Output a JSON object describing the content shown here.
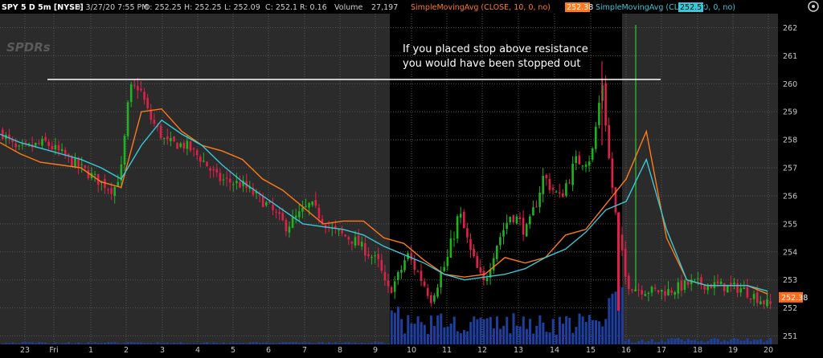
{
  "header": {
    "symbol": "SPY 5 D 5m [NYSE]",
    "date": "D: 3/27/20 7:55 PM",
    "open": "O: 252.25",
    "high": "H: 252.25",
    "low": "L: 252.09",
    "close": "C: 252.1",
    "range": "R: 0.16",
    "volume_label": "Volume",
    "volume_value": "27,197",
    "sma10_label": "SimpleMovingAvg (CLOSE, 10, 0, no)",
    "sma10_value": "252.38",
    "sma20_label": "SimpleMovingAvg (CLOSE, 20, 0, no)",
    "sma20_value": "252.57"
  },
  "watermark": "SPDRs",
  "annotation": {
    "line1": "If you placed stop above resistance",
    "line2": "you would have been stopped out"
  },
  "price_badge": "252.38",
  "colors": {
    "up": "#1fb31f",
    "down": "#e0204a",
    "sma10": "#ff7a1a",
    "sma20": "#3ac8d8",
    "volume": "#1f3f9e",
    "panel": "#2b2b2b",
    "highlight": "#000000",
    "resistance": "#ffffff",
    "badge": "#ff6a1a"
  },
  "chart_data": {
    "type": "candlestick",
    "ylim": [
      250.7,
      262.5
    ],
    "y_ticks": [
      "251",
      "252",
      "253",
      "254",
      "255",
      "256",
      "257",
      "258",
      "259",
      "260",
      "261",
      "262"
    ],
    "x_ticks": [
      "23",
      "Fri",
      "1",
      "2",
      "3",
      "4",
      "5",
      "6",
      "7",
      "8",
      "9",
      "10",
      "11",
      "12",
      "13",
      "14",
      "15",
      "16",
      "17",
      "18",
      "19",
      "20"
    ],
    "resistance_level": 260.15,
    "highlight_range": [
      "9:30",
      "15:40"
    ],
    "series": [
      {
        "name": "SimpleMovingAvg (CLOSE, 10, 0, no)",
        "points": [
          [
            0,
            257.9
          ],
          [
            1,
            257.5
          ],
          [
            2,
            257.2
          ],
          [
            3,
            257.1
          ],
          [
            4,
            257.0
          ],
          [
            5,
            256.5
          ],
          [
            6,
            256.3
          ],
          [
            7,
            259.0
          ],
          [
            8,
            259.1
          ],
          [
            9,
            258.3
          ],
          [
            10,
            257.8
          ],
          [
            11,
            257.6
          ],
          [
            12,
            257.3
          ],
          [
            13,
            256.6
          ],
          [
            14,
            256.2
          ],
          [
            15,
            255.6
          ],
          [
            16,
            255.0
          ],
          [
            17,
            255.1
          ],
          [
            18,
            255.1
          ],
          [
            19,
            254.5
          ],
          [
            20,
            254.3
          ],
          [
            21,
            253.7
          ],
          [
            22,
            253.2
          ],
          [
            23,
            253.1
          ],
          [
            24,
            253.2
          ],
          [
            25,
            253.8
          ],
          [
            26,
            253.6
          ],
          [
            27,
            253.8
          ],
          [
            28,
            254.6
          ],
          [
            29,
            254.8
          ],
          [
            30,
            255.7
          ],
          [
            31,
            256.6
          ],
          [
            32,
            258.3
          ],
          [
            33,
            254.5
          ],
          [
            34,
            253.0
          ],
          [
            35,
            252.8
          ],
          [
            36,
            252.8
          ],
          [
            37,
            252.8
          ],
          [
            38,
            252.5
          ]
        ]
      },
      {
        "name": "SimpleMovingAvg (CLOSE, 20, 0, no)",
        "points": [
          [
            0,
            258.2
          ],
          [
            1,
            257.9
          ],
          [
            2,
            257.7
          ],
          [
            3,
            257.5
          ],
          [
            4,
            257.3
          ],
          [
            5,
            257.0
          ],
          [
            6,
            256.6
          ],
          [
            7,
            257.8
          ],
          [
            8,
            258.7
          ],
          [
            9,
            258.2
          ],
          [
            10,
            257.8
          ],
          [
            11,
            257.1
          ],
          [
            12,
            256.5
          ],
          [
            13,
            256.0
          ],
          [
            14,
            255.5
          ],
          [
            15,
            255.0
          ],
          [
            16,
            254.9
          ],
          [
            17,
            254.8
          ],
          [
            18,
            254.6
          ],
          [
            19,
            254.2
          ],
          [
            20,
            253.9
          ],
          [
            21,
            253.6
          ],
          [
            22,
            253.2
          ],
          [
            23,
            253.0
          ],
          [
            24,
            253.1
          ],
          [
            25,
            253.2
          ],
          [
            26,
            253.4
          ],
          [
            27,
            253.8
          ],
          [
            28,
            254.1
          ],
          [
            29,
            254.7
          ],
          [
            30,
            255.5
          ],
          [
            31,
            255.8
          ],
          [
            32,
            257.3
          ],
          [
            33,
            254.8
          ],
          [
            34,
            253.0
          ],
          [
            35,
            252.8
          ],
          [
            36,
            252.8
          ],
          [
            37,
            252.8
          ],
          [
            38,
            252.6
          ]
        ]
      }
    ]
  }
}
